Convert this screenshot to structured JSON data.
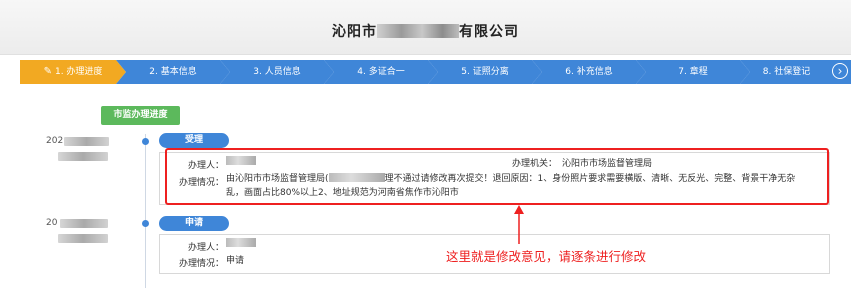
{
  "header": {
    "company_prefix": "沁阳市",
    "company_suffix": "有限公司"
  },
  "steps": [
    {
      "label": "1. 办理进度",
      "active": true
    },
    {
      "label": "2. 基本信息",
      "active": false
    },
    {
      "label": "3. 人员信息",
      "active": false
    },
    {
      "label": "4. 多证合一",
      "active": false
    },
    {
      "label": "5. 证照分离",
      "active": false
    },
    {
      "label": "6. 补充信息",
      "active": false
    },
    {
      "label": "7. 章程",
      "active": false
    },
    {
      "label": "8. 社保登记",
      "active": false
    }
  ],
  "progress_button": "市监办理进度",
  "timeline": [
    {
      "year": "202",
      "status": "受理",
      "handler_label": "办理人：",
      "agency_label": "办理机关：",
      "agency": "沁阳市市场监督管理局",
      "situation_label": "办理情况：",
      "situation_part1": "由沁阳市市场监督管理局(",
      "situation_part2": "理不通过请修改再次提交！退回原因：1、身份照片要求需要横版、清晰、无反光、完整、背景干净无杂",
      "situation_line2": "乱，画面占比80%以上2、地址规范为河南省焦作市沁阳市"
    },
    {
      "year": "20",
      "status": "申请",
      "handler_label": "办理人：",
      "situation_label": "办理情况：",
      "situation": "申请"
    }
  ],
  "annotation": "这里就是修改意见，请逐条进行修改",
  "colors": {
    "active_step": "#f2a922",
    "step": "#3f86d8",
    "green": "#5cb95c",
    "annotation_red": "#ee2020"
  }
}
